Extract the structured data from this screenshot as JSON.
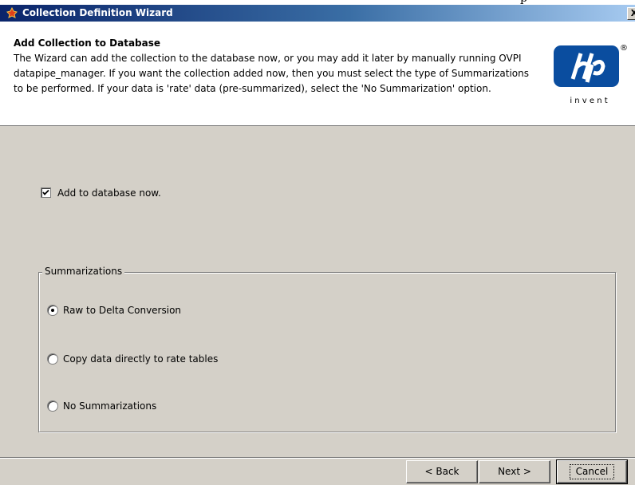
{
  "window": {
    "title": "Collection Definition Wizard",
    "close_glyph": "X",
    "icon": "app-icon"
  },
  "header": {
    "title": "Add Collection to Database",
    "description": "The Wizard can add the collection to the database now, or you may add it later by manually running OVPI datapipe_manager. If you want the collection added now, then you must select the type of Summarizations to be performed. If your data is 'rate' data (pre-summarized), select the 'No Summarization' option.",
    "logo": {
      "mark": "hp",
      "tagline": "i n v e n t",
      "registered": "®",
      "color": "#0a4d9f"
    }
  },
  "options": {
    "add_now": {
      "label": "Add to database now.",
      "checked": true
    },
    "summarizations": {
      "legend": "Summarizations",
      "items": [
        {
          "label": "Raw to Delta Conversion",
          "selected": true
        },
        {
          "label": "Copy data directly to rate tables",
          "selected": false
        },
        {
          "label": "No Summarizations",
          "selected": false
        }
      ]
    }
  },
  "footer": {
    "back_label": "< Back",
    "next_label": "Next >",
    "cancel_label": "Cancel"
  },
  "background_fragment": "p"
}
